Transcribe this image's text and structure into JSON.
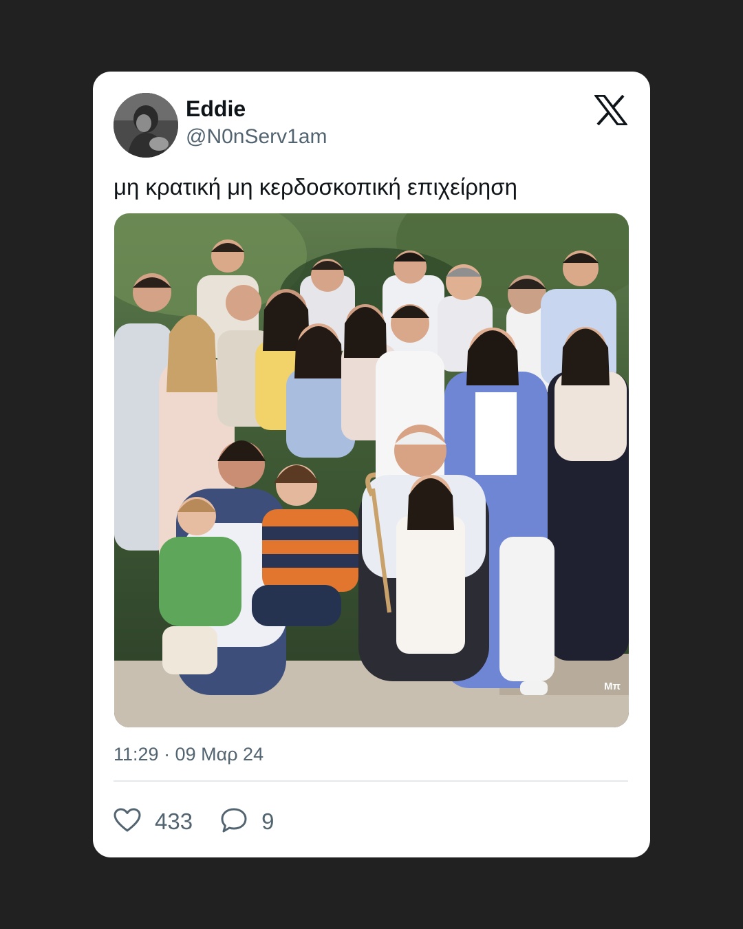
{
  "tweet": {
    "author": {
      "name": "Eddie",
      "handle": "@N0nServ1am",
      "avatar_icon": "profile-photo"
    },
    "platform_icon": "x-logo-icon",
    "text": "μη κρατική μη κερδοσκοπική επιχείρηση",
    "media": {
      "type": "photo",
      "caption_overlay": "Μπ"
    },
    "timestamp": "11:29 · 09 Μαρ 24",
    "stats": {
      "likes": "433",
      "replies": "9"
    },
    "icons": {
      "like": "heart-icon",
      "reply": "speech-bubble-icon"
    }
  },
  "colors": {
    "background": "#212121",
    "card": "#ffffff",
    "text_primary": "#0f1419",
    "text_secondary": "#536471"
  }
}
